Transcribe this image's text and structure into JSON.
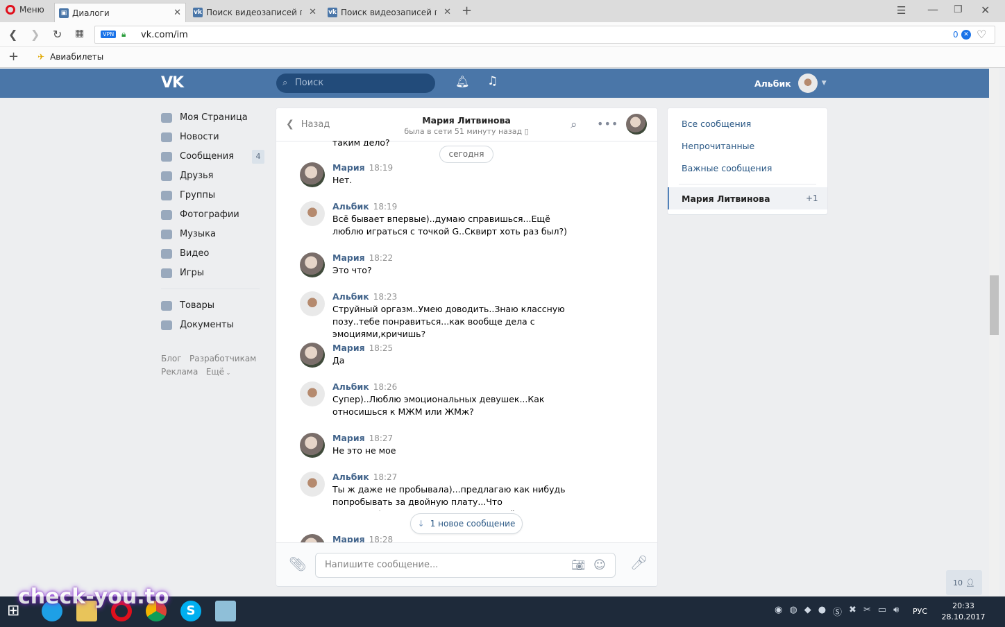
{
  "browser": {
    "menu_label": "Меню",
    "tabs": [
      {
        "title": "Диалоги"
      },
      {
        "title": "Поиск видеозаписей по запросу"
      },
      {
        "title": "Поиск видеозаписей по запросу"
      }
    ],
    "vpn_badge": "VPN",
    "url": "vk.com/im",
    "adblock_count": "0",
    "bookmarks": [
      {
        "label": "Авиабилеты"
      }
    ]
  },
  "vk_header": {
    "search_placeholder": "Поиск",
    "user_name": "Альбик"
  },
  "sidebar": {
    "items": [
      {
        "label": "Моя Страница"
      },
      {
        "label": "Новости"
      },
      {
        "label": "Сообщения",
        "badge": "4"
      },
      {
        "label": "Друзья"
      },
      {
        "label": "Группы"
      },
      {
        "label": "Фотографии"
      },
      {
        "label": "Музыка"
      },
      {
        "label": "Видео"
      },
      {
        "label": "Игры"
      }
    ],
    "items2": [
      {
        "label": "Товары"
      },
      {
        "label": "Документы"
      }
    ],
    "footer": {
      "blog": "Блог",
      "dev": "Разработчикам",
      "ads": "Реклама",
      "more": "Ещё"
    }
  },
  "chat": {
    "back_label": "Назад",
    "contact_name": "Мария Литвинова",
    "contact_status": "была в сети 51 минуту назад",
    "partial_top_text": "таким дело?",
    "date_separator": "сегодня",
    "messages": [
      {
        "author": "Мария",
        "time": "18:19",
        "text": "Нет."
      },
      {
        "author": "Альбик",
        "time": "18:19",
        "text": "Всё бывает впервые)..думаю справишься...Ещё люблю играться с точкой G..Сквирт хоть раз был?)"
      },
      {
        "author": "Мария",
        "time": "18:22",
        "text": "Это что?"
      },
      {
        "author": "Альбик",
        "time": "18:23",
        "text": "Струйный оргазм..Умею доводить..Знаю классную позу..тебе понравиться...как вообще дела с эмоциями,кричишь?"
      },
      {
        "author": "Мария",
        "time": "18:25",
        "text": "Да"
      },
      {
        "author": "Альбик",
        "time": "18:26",
        "text": "Супер)..Люблю эмоциональных девушек...Как относишься к МЖМ или ЖМж?"
      },
      {
        "author": "Мария",
        "time": "18:27",
        "text": "Не это не мое"
      },
      {
        "author": "Альбик",
        "time": "18:27",
        "text": "Ты ж даже не пробывала)...предлагаю как нибудь попробывать за двойную плату...Что скажешь?)...Считаю в жизни нужно всё по..."
      },
      {
        "author": "Мария",
        "time": "18:28",
        "text": ""
      }
    ],
    "new_message_pill": "1 новое сообщение",
    "input_placeholder": "Напишите сообщение..."
  },
  "right_panel": {
    "filters": [
      {
        "label": "Все сообщения"
      },
      {
        "label": "Непрочитанные"
      },
      {
        "label": "Важные сообщения"
      }
    ],
    "active_dialog": {
      "name": "Мария Литвинова",
      "count": "+1"
    }
  },
  "friends_online": {
    "count": "10"
  },
  "watermark": {
    "text": "check-you.to"
  },
  "taskbar": {
    "lang": "РУС",
    "time": "20:33",
    "date": "28.10.2017"
  }
}
